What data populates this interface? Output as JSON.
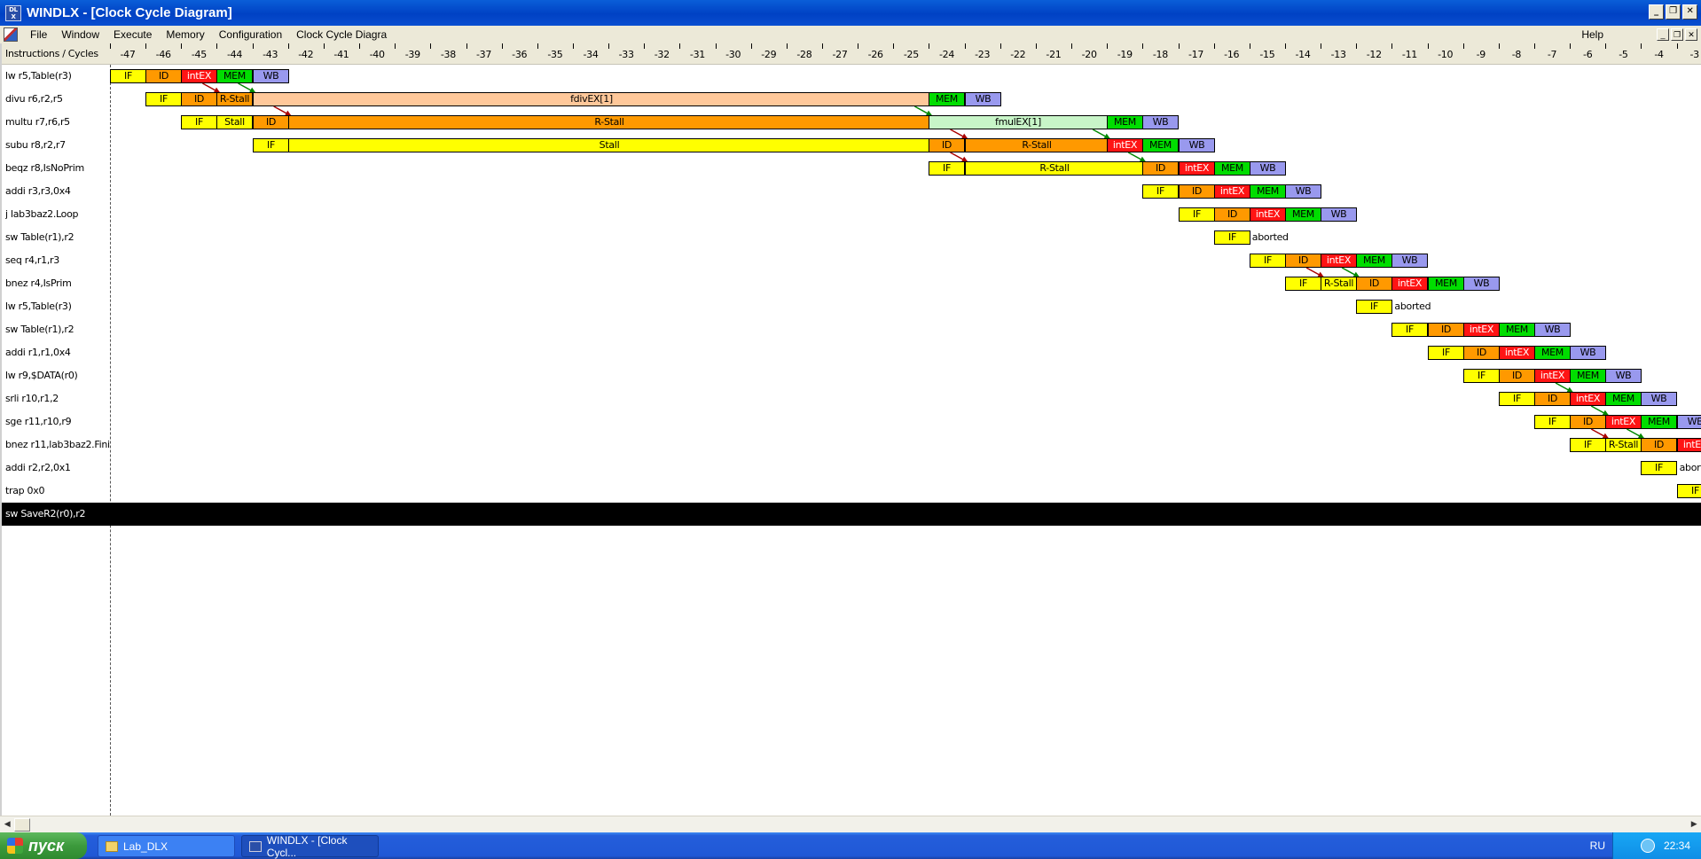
{
  "window": {
    "title": "WINDLX - [Clock Cycle Diagram]",
    "icon_name": "windlx-app-icon",
    "controls": [
      "_",
      "❐",
      "✕"
    ]
  },
  "menu": {
    "items": [
      "File",
      "Window",
      "Execute",
      "Memory",
      "Configuration",
      "Clock Cycle Diagra"
    ],
    "help": "Help",
    "mdi_controls": [
      "_",
      "❐",
      "✕"
    ]
  },
  "diagram": {
    "header_label": "Instructions / Cycles",
    "first_cycle": -47,
    "last_cycle": -3,
    "colors": {
      "IF": "#ffff00",
      "ID": "#ff9900",
      "Stall": "#ffff00",
      "R-Stall": "#ff9900",
      "intEX": "#ff1414",
      "MEM": "#00dd00",
      "WB": "#9999ee",
      "fdivEX": "#ffc89a",
      "fmulEX": "#c8f5c8"
    },
    "rows": [
      {
        "label": "lw r5,Table(r3)",
        "stages": [
          {
            "t": "IF",
            "c": -47,
            "n": 1
          },
          {
            "t": "ID",
            "c": -46,
            "n": 1
          },
          {
            "t": "intEX",
            "c": -45,
            "n": 1
          },
          {
            "t": "MEM",
            "c": -44,
            "n": 1
          },
          {
            "t": "WB",
            "c": -43,
            "n": 1
          }
        ]
      },
      {
        "label": "divu r6,r2,r5",
        "stages": [
          {
            "t": "IF",
            "c": -46,
            "n": 1
          },
          {
            "t": "ID",
            "c": -45,
            "n": 1
          },
          {
            "t": "R-Stall",
            "c": -44,
            "n": 1,
            "k": "R-Stall"
          },
          {
            "t": "fdivEX[1]",
            "c": -43,
            "n": 19,
            "k": "fdivEX"
          },
          {
            "t": "MEM",
            "c": -24,
            "n": 1
          },
          {
            "t": "WB",
            "c": -23,
            "n": 1
          }
        ]
      },
      {
        "label": "multu r7,r6,r5",
        "stages": [
          {
            "t": "IF",
            "c": -45,
            "n": 1
          },
          {
            "t": "Stall",
            "c": -44,
            "n": 1
          },
          {
            "t": "ID",
            "c": -43,
            "n": 1
          },
          {
            "t": "R-Stall",
            "c": -42,
            "n": 18,
            "k": "R-Stall"
          },
          {
            "t": "fmulEX[1]",
            "c": -24,
            "n": 5,
            "k": "fmulEX"
          },
          {
            "t": "MEM",
            "c": -19,
            "n": 1
          },
          {
            "t": "WB",
            "c": -18,
            "n": 1
          }
        ]
      },
      {
        "label": "subu r8,r2,r7",
        "stages": [
          {
            "t": "IF",
            "c": -43,
            "n": 1
          },
          {
            "t": "Stall",
            "c": -42,
            "n": 18
          },
          {
            "t": "ID",
            "c": -24,
            "n": 1
          },
          {
            "t": "R-Stall",
            "c": -23,
            "n": 4,
            "k": "R-Stall"
          },
          {
            "t": "intEX",
            "c": -19,
            "n": 1
          },
          {
            "t": "MEM",
            "c": -18,
            "n": 1
          },
          {
            "t": "WB",
            "c": -17,
            "n": 1
          }
        ]
      },
      {
        "label": "beqz r8,IsNoPrim",
        "stages": [
          {
            "t": "IF",
            "c": -24,
            "n": 1
          },
          {
            "t": "R-Stall",
            "c": -23,
            "n": 5,
            "k": "Stall"
          },
          {
            "t": "ID",
            "c": -18,
            "n": 1
          },
          {
            "t": "intEX",
            "c": -17,
            "n": 1
          },
          {
            "t": "MEM",
            "c": -16,
            "n": 1
          },
          {
            "t": "WB",
            "c": -15,
            "n": 1
          }
        ]
      },
      {
        "label": "addi r3,r3,0x4",
        "stages": [
          {
            "t": "IF",
            "c": -18,
            "n": 1
          },
          {
            "t": "ID",
            "c": -17,
            "n": 1
          },
          {
            "t": "intEX",
            "c": -16,
            "n": 1
          },
          {
            "t": "MEM",
            "c": -15,
            "n": 1
          },
          {
            "t": "WB",
            "c": -14,
            "n": 1
          }
        ]
      },
      {
        "label": "j lab3baz2.Loop",
        "stages": [
          {
            "t": "IF",
            "c": -17,
            "n": 1
          },
          {
            "t": "ID",
            "c": -16,
            "n": 1
          },
          {
            "t": "intEX",
            "c": -15,
            "n": 1
          },
          {
            "t": "MEM",
            "c": -14,
            "n": 1
          },
          {
            "t": "WB",
            "c": -13,
            "n": 1
          }
        ]
      },
      {
        "label": "sw Table(r1),r2",
        "stages": [
          {
            "t": "IF",
            "c": -16,
            "n": 1
          }
        ],
        "note": "aborted",
        "note_c": -15
      },
      {
        "label": "seq r4,r1,r3",
        "stages": [
          {
            "t": "IF",
            "c": -15,
            "n": 1
          },
          {
            "t": "ID",
            "c": -14,
            "n": 1
          },
          {
            "t": "intEX",
            "c": -13,
            "n": 1
          },
          {
            "t": "MEM",
            "c": -12,
            "n": 1
          },
          {
            "t": "WB",
            "c": -11,
            "n": 1
          }
        ]
      },
      {
        "label": "bnez r4,IsPrim",
        "stages": [
          {
            "t": "IF",
            "c": -14,
            "n": 1
          },
          {
            "t": "R-Stall",
            "c": -13,
            "n": 1,
            "k": "Stall"
          },
          {
            "t": "ID",
            "c": -12,
            "n": 1
          },
          {
            "t": "intEX",
            "c": -11,
            "n": 1
          },
          {
            "t": "MEM",
            "c": -10,
            "n": 1
          },
          {
            "t": "WB",
            "c": -9,
            "n": 1
          }
        ]
      },
      {
        "label": "lw r5,Table(r3)",
        "stages": [
          {
            "t": "IF",
            "c": -12,
            "n": 1
          }
        ],
        "note": "aborted",
        "note_c": -11
      },
      {
        "label": "sw Table(r1),r2",
        "stages": [
          {
            "t": "IF",
            "c": -11,
            "n": 1
          },
          {
            "t": "ID",
            "c": -10,
            "n": 1
          },
          {
            "t": "intEX",
            "c": -9,
            "n": 1
          },
          {
            "t": "MEM",
            "c": -8,
            "n": 1
          },
          {
            "t": "WB",
            "c": -7,
            "n": 1
          }
        ]
      },
      {
        "label": "addi r1,r1,0x4",
        "stages": [
          {
            "t": "IF",
            "c": -10,
            "n": 1
          },
          {
            "t": "ID",
            "c": -9,
            "n": 1
          },
          {
            "t": "intEX",
            "c": -8,
            "n": 1
          },
          {
            "t": "MEM",
            "c": -7,
            "n": 1
          },
          {
            "t": "WB",
            "c": -6,
            "n": 1
          }
        ]
      },
      {
        "label": "lw r9,$DATA(r0)",
        "stages": [
          {
            "t": "IF",
            "c": -9,
            "n": 1
          },
          {
            "t": "ID",
            "c": -8,
            "n": 1
          },
          {
            "t": "intEX",
            "c": -7,
            "n": 1
          },
          {
            "t": "MEM",
            "c": -6,
            "n": 1
          },
          {
            "t": "WB",
            "c": -5,
            "n": 1
          }
        ]
      },
      {
        "label": "srli r10,r1,2",
        "stages": [
          {
            "t": "IF",
            "c": -8,
            "n": 1
          },
          {
            "t": "ID",
            "c": -7,
            "n": 1
          },
          {
            "t": "intEX",
            "c": -6,
            "n": 1
          },
          {
            "t": "MEM",
            "c": -5,
            "n": 1
          },
          {
            "t": "WB",
            "c": -4,
            "n": 1
          }
        ]
      },
      {
        "label": "sge r11,r10,r9",
        "stages": [
          {
            "t": "IF",
            "c": -7,
            "n": 1
          },
          {
            "t": "ID",
            "c": -6,
            "n": 1
          },
          {
            "t": "intEX",
            "c": -5,
            "n": 1
          },
          {
            "t": "MEM",
            "c": -4,
            "n": 1
          },
          {
            "t": "WB",
            "c": -3,
            "n": 1
          }
        ]
      },
      {
        "label": "bnez r11,lab3baz2.Finish",
        "stages": [
          {
            "t": "IF",
            "c": -6,
            "n": 1
          },
          {
            "t": "R-Stall",
            "c": -5,
            "n": 1,
            "k": "Stall"
          },
          {
            "t": "ID",
            "c": -4,
            "n": 1
          },
          {
            "t": "intEX",
            "c": -3,
            "n": 1
          }
        ]
      },
      {
        "label": "addi r2,r2,0x1",
        "stages": [
          {
            "t": "IF",
            "c": -4,
            "n": 1
          }
        ],
        "note": "aborted",
        "note_c": -3
      },
      {
        "label": "trap 0x0",
        "stages": [
          {
            "t": "IF",
            "c": -3,
            "n": 1
          }
        ]
      },
      {
        "label": "sw SaveR2(r0),r2",
        "stages": [],
        "selected": true
      }
    ],
    "arrows": [
      {
        "from_row": 0,
        "from_c": -45,
        "to_row": 1,
        "to_c": -44,
        "color": "#aa0000"
      },
      {
        "from_row": 0,
        "from_c": -44,
        "to_row": 1,
        "to_c": -43,
        "color": "#008800"
      },
      {
        "from_row": 1,
        "from_c": -43,
        "to_row": 2,
        "to_c": -42,
        "color": "#aa0000"
      },
      {
        "from_row": 1,
        "from_c": -25,
        "to_row": 2,
        "to_c": -24,
        "color": "#008800"
      },
      {
        "from_row": 2,
        "from_c": -24,
        "to_row": 3,
        "to_c": -23,
        "color": "#aa0000"
      },
      {
        "from_row": 2,
        "from_c": -20,
        "to_row": 3,
        "to_c": -19,
        "color": "#008800"
      },
      {
        "from_row": 3,
        "from_c": -24,
        "to_row": 4,
        "to_c": -23,
        "color": "#aa0000"
      },
      {
        "from_row": 3,
        "from_c": -19,
        "to_row": 4,
        "to_c": -18,
        "color": "#008800"
      },
      {
        "from_row": 8,
        "from_c": -14,
        "to_row": 9,
        "to_c": -13,
        "color": "#aa0000"
      },
      {
        "from_row": 8,
        "from_c": -13,
        "to_row": 9,
        "to_c": -12,
        "color": "#008800"
      },
      {
        "from_row": 13,
        "from_c": -7,
        "to_row": 14,
        "to_c": -6,
        "color": "#008800"
      },
      {
        "from_row": 14,
        "from_c": -6,
        "to_row": 15,
        "to_c": -5,
        "color": "#008800"
      },
      {
        "from_row": 15,
        "from_c": -6,
        "to_row": 16,
        "to_c": -5,
        "color": "#aa0000"
      },
      {
        "from_row": 15,
        "from_c": -5,
        "to_row": 16,
        "to_c": -4,
        "color": "#008800"
      }
    ]
  },
  "taskbar": {
    "start_label": "пуск",
    "buttons": [
      "Lab_DLX",
      "WINDLX - [Clock Cycl..."
    ],
    "language": "RU",
    "clock": "22:34"
  }
}
